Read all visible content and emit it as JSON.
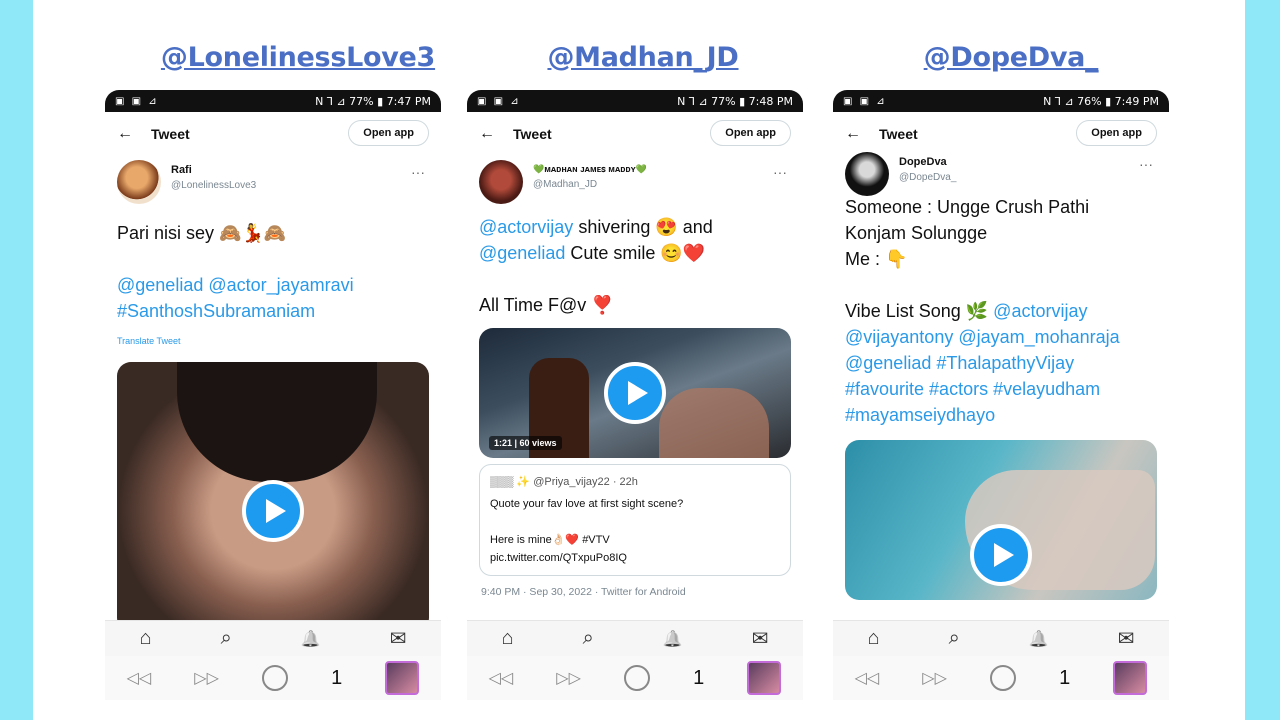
{
  "panels": [
    {
      "caption": "@LonelinessLove3",
      "status_left": "▣ ▣ ⊿",
      "status_right": "N ⅂ ⊿ 77% ▮ 7:47 PM",
      "top_title": "Tweet",
      "open_app": "Open app",
      "author_name": "Rafi",
      "author_handle": "@LonelinessLove3",
      "text_lines": [
        "Pari nisi sey 🙈💃🙈"
      ],
      "links": [
        "@geneliad @actor_jayamravi",
        "#SanthoshSubramaniam"
      ],
      "translate": "Translate Tweet",
      "video_caption": ""
    },
    {
      "caption": "@Madhan_JD",
      "status_left": "▣ ▣ ⊿",
      "status_right": "N ⅂ ⊿ 77% ▮ 7:48 PM",
      "top_title": "Tweet",
      "open_app": "Open app",
      "author_name": "💚ᴍᴀᴅʜᴀɴ ᴊᴀᴍᴇꜱ ᴍᴀᴅᴅʏ💚",
      "author_handle": "@Madhan_JD",
      "line1_link": "@actorvijay",
      "line1_text": " shivering 😍 and",
      "line2_link": "@geneliad",
      "line2_text": " Cute smile 😊❤️",
      "line3": "All Time F@v ❣️",
      "video_caption": "1:21 | 60 views",
      "quote_head": "▒▒▒ ✨ @Priya_vijay22 · 22h",
      "quote_line1": "Quote your fav love at first sight scene?",
      "quote_line2": "Here is mine👌🏻❤️ #VTV",
      "quote_line3": "pic.twitter.com/QTxpuPo8IQ",
      "meta": "9:40 PM · Sep 30, 2022 · Twitter for Android"
    },
    {
      "caption": "@DopeDva_",
      "status_left": "▣ ▣ ⊿",
      "status_right": "N ⅂ ⊿ 76% ▮ 7:49 PM",
      "top_title": "Tweet",
      "open_app": "Open app",
      "author_name": "DopeDva",
      "author_handle": "@DopeDva_",
      "line1": "Someone : Ungge Crush Pathi",
      "line2": "Konjam Solungge",
      "line3": "Me : 👇",
      "line4_text": "Vibe List Song 🌿 ",
      "line4_link": "@actorvijay",
      "line5": "@vijayantony @jayam_mohanraja",
      "line6": "@geneliad #ThalapathyVijay",
      "line7": "#favourite #actors #velayudham",
      "line8": "#mayamseiydhayo"
    }
  ],
  "nav": {
    "home": "⌂",
    "search": "⌕",
    "bell": "🔔",
    "mail": "✉",
    "back": "◁◁",
    "forward": "▷▷",
    "count": "1"
  },
  "icons": {
    "back_arrow": "←",
    "more": "···"
  },
  "colors": {
    "link": "#2a9ae8",
    "caption": "#4a6fc4",
    "play": "#1d9bf0",
    "side_bg": "#8ee8f7"
  }
}
